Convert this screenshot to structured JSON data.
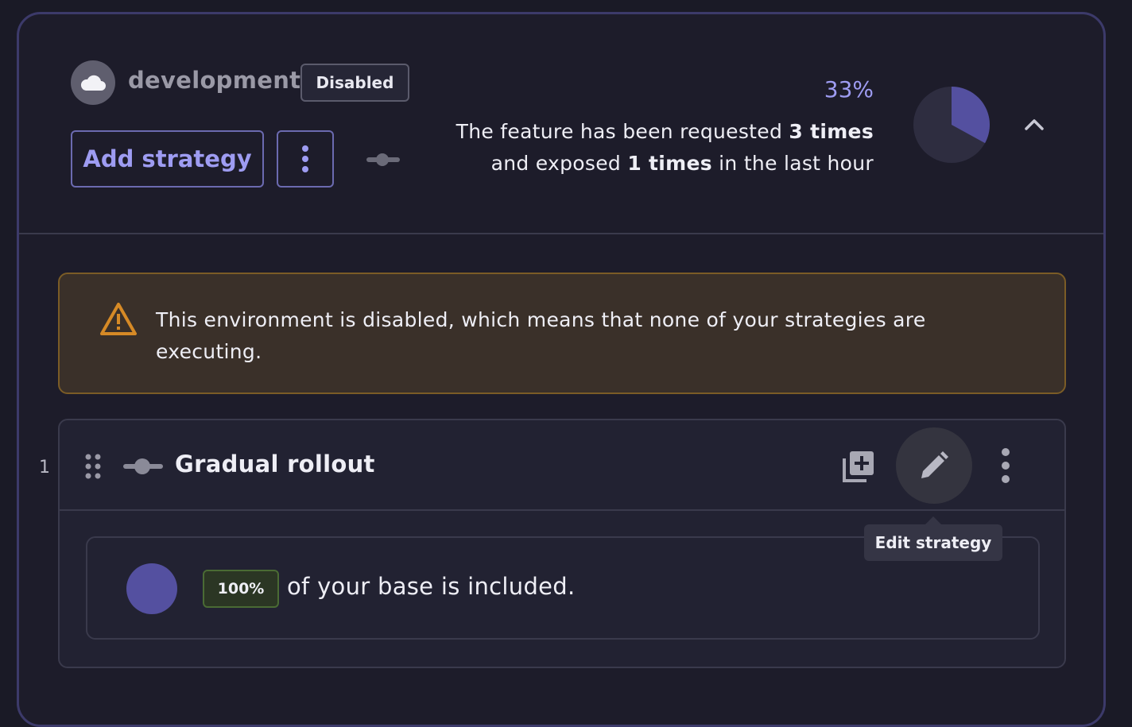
{
  "environment": {
    "name": "development",
    "status_badge": "Disabled",
    "add_strategy_label": "Add strategy"
  },
  "metrics": {
    "percentage": "33%",
    "exposed_fraction": 0.33,
    "line1_prefix": "The feature has been requested ",
    "requested": "3 times",
    "line2_prefix": "and exposed ",
    "exposed": "1 times",
    "line2_suffix": " in the last hour"
  },
  "warning": {
    "text": "This environment is disabled, which means that none of your strategies are executing."
  },
  "strategy": {
    "index": "1",
    "title": "Gradual rollout",
    "rollout_badge": "100%",
    "rollout_text": "of your base is included.",
    "rollout_fraction": 1.0
  },
  "tooltip": {
    "text": "Edit strategy"
  },
  "colors": {
    "accent": "#9e9cf2",
    "pie_filled": "#5450a0",
    "pie_empty": "#2e2d40",
    "warning_border": "#7b5c26",
    "warning_icon": "#d68a26"
  },
  "icons": {
    "environment": "cloud-icon",
    "menu": "more-vertical-icon",
    "toggle": "toggle-off-icon",
    "collapse": "chevron-up-icon",
    "warning": "warning-triangle-icon",
    "drag": "drag-handle-icon",
    "copy": "copy-add-icon",
    "edit": "pencil-icon"
  }
}
